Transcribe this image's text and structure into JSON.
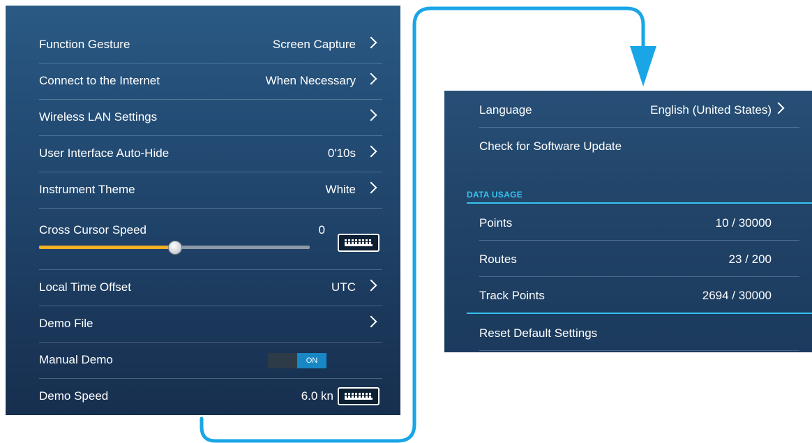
{
  "left_panel": {
    "rows": [
      {
        "label": "Function Gesture",
        "value": "Screen Capture"
      },
      {
        "label": "Connect to the Internet",
        "value": "When Necessary"
      },
      {
        "label": "Wireless LAN Settings",
        "value": ""
      },
      {
        "label": "User Interface Auto-Hide",
        "value": "0'10s"
      },
      {
        "label": "Instrument Theme",
        "value": "White"
      }
    ],
    "cross_cursor": {
      "label": "Cross Cursor Speed",
      "value": "0",
      "slider_fraction": 0.5
    },
    "rows2": [
      {
        "label": "Local Time Offset",
        "value": "UTC"
      },
      {
        "label": "Demo File",
        "value": ""
      }
    ],
    "manual_demo": {
      "label": "Manual Demo",
      "toggle_text": "ON"
    },
    "demo_speed": {
      "label": "Demo Speed",
      "value": "6.0 kn"
    }
  },
  "right_panel": {
    "language": {
      "label": "Language",
      "value": "English (United States)"
    },
    "software_update": {
      "label": "Check for Software Update"
    },
    "section_title": "DATA USAGE",
    "usage": [
      {
        "label": "Points",
        "value": "10 / 30000"
      },
      {
        "label": "Routes",
        "value": "23 / 200"
      },
      {
        "label": "Track Points",
        "value": "2694 / 30000"
      }
    ],
    "reset": {
      "label": "Reset Default Settings"
    }
  },
  "colors": {
    "accent_cyan": "#35c2ef",
    "slider_fill": "#f3b025",
    "toggle_on": "#1787c6",
    "connector": "#1aa6e6"
  }
}
